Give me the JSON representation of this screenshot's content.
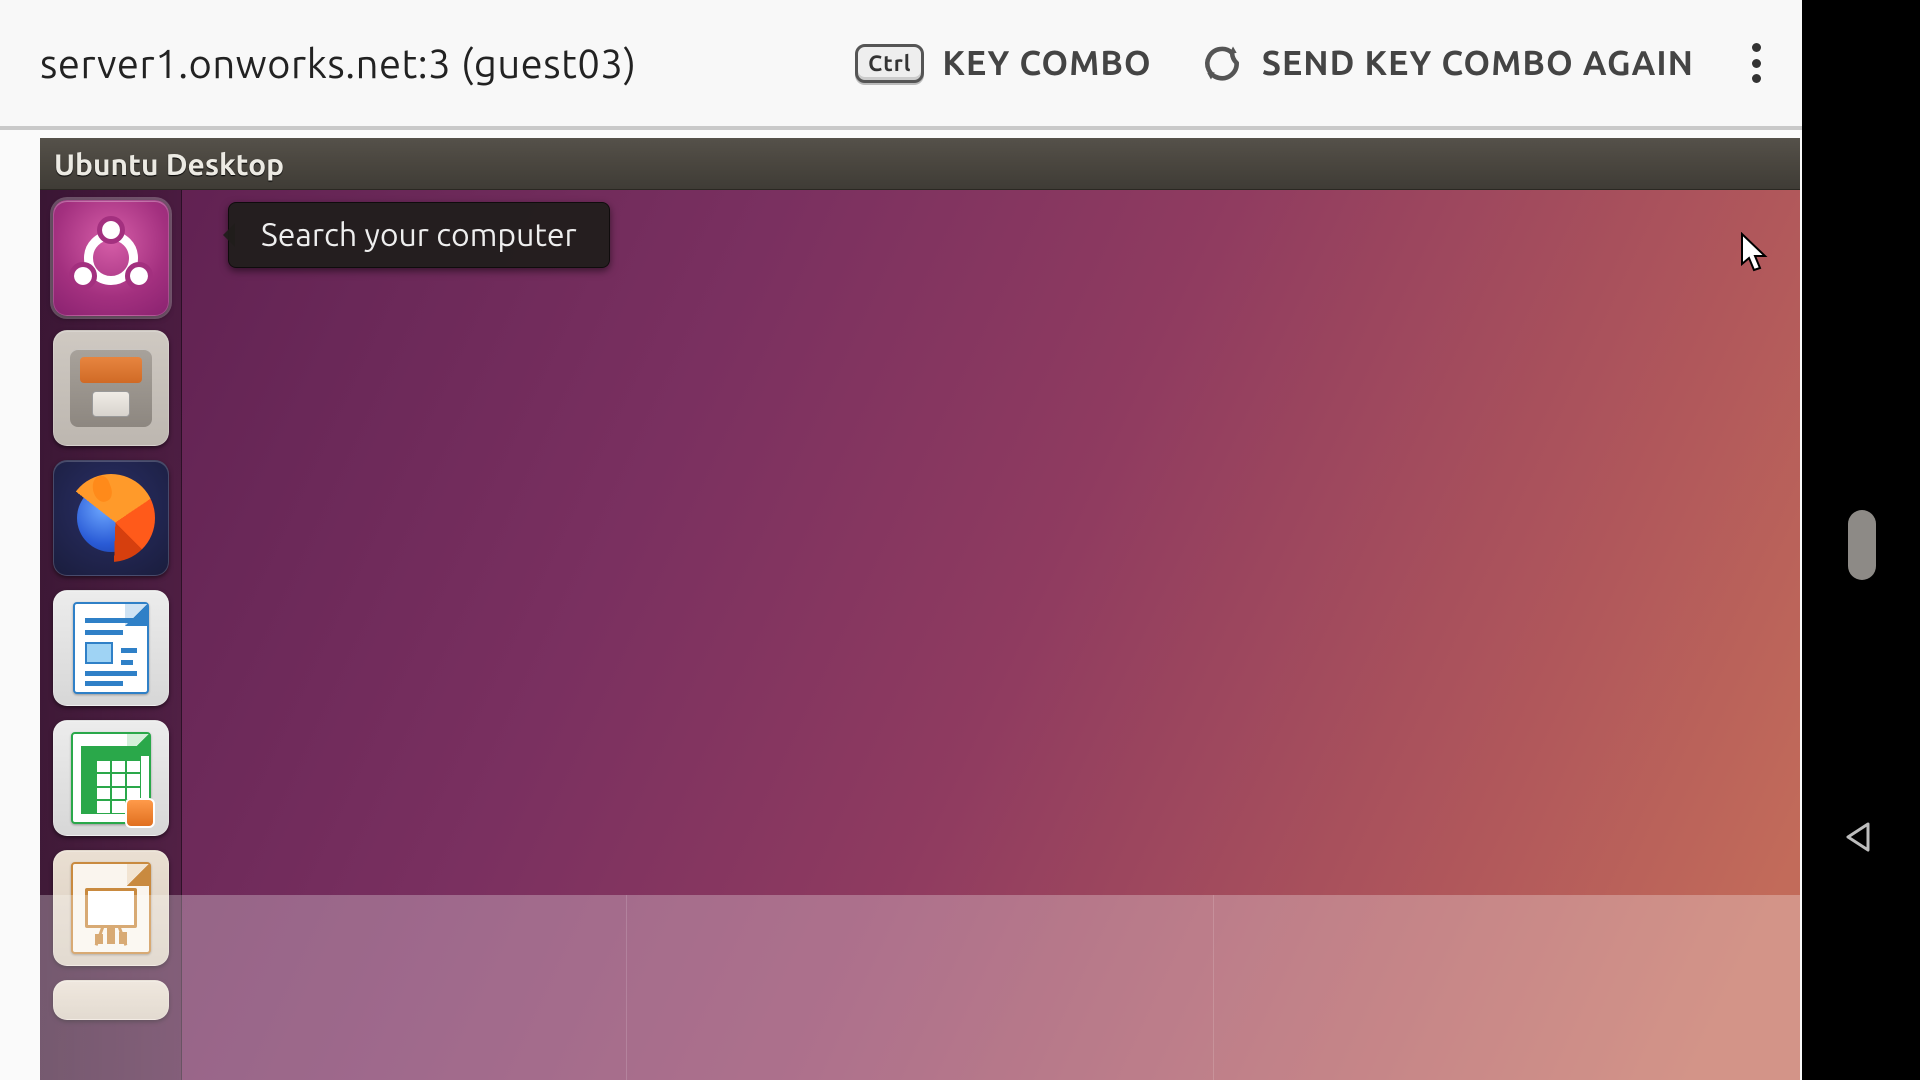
{
  "colors": {
    "ubuntu_purple": "#6a2858",
    "ubuntu_orange": "#e95420",
    "toolbar_bg": "#f8f8f8",
    "menubar_bg": "#4a463f"
  },
  "topbar": {
    "hostname": "server1.onworks.net:3 (guest03)",
    "ctrl_key_label": "Ctrl",
    "key_combo_label": "KEY COMBO",
    "send_again_label": "SEND KEY COMBO AGAIN"
  },
  "menubar": {
    "title": "Ubuntu Desktop"
  },
  "tooltip": {
    "text": "Search your computer"
  },
  "launcher": {
    "items": [
      {
        "id": "dash",
        "label": "Search your computer",
        "icon": "ubuntu-dash-icon",
        "active": true
      },
      {
        "id": "files",
        "label": "Files",
        "icon": "files-icon",
        "active": false
      },
      {
        "id": "firefox",
        "label": "Firefox Web Browser",
        "icon": "firefox-icon",
        "active": false
      },
      {
        "id": "writer",
        "label": "LibreOffice Writer",
        "icon": "libreoffice-writer-icon",
        "active": false
      },
      {
        "id": "calc",
        "label": "LibreOffice Calc",
        "icon": "libreoffice-calc-icon",
        "active": false
      },
      {
        "id": "impress",
        "label": "LibreOffice Impress",
        "icon": "libreoffice-impress-icon",
        "active": false
      }
    ]
  },
  "android_nav": {
    "back_label": "Back"
  }
}
